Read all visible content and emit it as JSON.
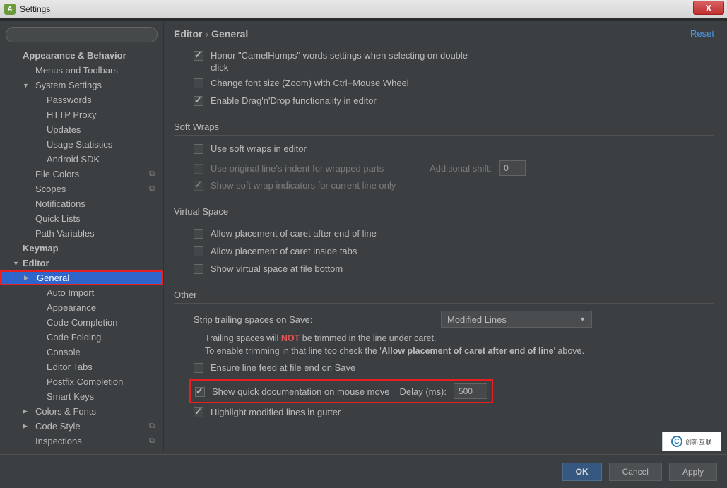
{
  "window": {
    "title": "Settings"
  },
  "search": {
    "placeholder": ""
  },
  "breadcrumb": {
    "root": "Editor",
    "leaf": "General"
  },
  "reset": "Reset",
  "tree": {
    "appearance": "Appearance & Behavior",
    "menus": "Menus and Toolbars",
    "system": "System Settings",
    "passwords": "Passwords",
    "http": "HTTP Proxy",
    "updates": "Updates",
    "usage": "Usage Statistics",
    "sdk": "Android SDK",
    "filecolors": "File Colors",
    "scopes": "Scopes",
    "notifications": "Notifications",
    "quicklists": "Quick Lists",
    "pathvars": "Path Variables",
    "keymap": "Keymap",
    "editor": "Editor",
    "general": "General",
    "autoimport": "Auto Import",
    "appearance2": "Appearance",
    "codecompletion": "Code Completion",
    "codefolding": "Code Folding",
    "console": "Console",
    "editortabs": "Editor Tabs",
    "postfix": "Postfix Completion",
    "smartkeys": "Smart Keys",
    "colorsfonts": "Colors & Fonts",
    "codestyle": "Code Style",
    "inspections": "Inspections"
  },
  "opts": {
    "camelhumps": "Honor \"CamelHumps\" words settings when selecting on double click",
    "zoom": "Change font size (Zoom) with Ctrl+Mouse Wheel",
    "dnd": "Enable Drag'n'Drop functionality in editor",
    "softwraps_title": "Soft Wraps",
    "softwraps": "Use soft wraps in editor",
    "origindent": "Use original line's indent for wrapped parts",
    "addshift": "Additional shift:",
    "addshift_val": "0",
    "indicators": "Show soft wrap indicators for current line only",
    "vspace_title": "Virtual Space",
    "caret_eol": "Allow placement of caret after end of line",
    "caret_tabs": "Allow placement of caret inside tabs",
    "vspace_bottom": "Show virtual space at file bottom",
    "other_title": "Other",
    "strip": "Strip trailing spaces on Save:",
    "strip_select": "Modified Lines",
    "note1a": "Trailing spaces will ",
    "note1b": "NOT",
    "note1c": " be trimmed in the line under caret.",
    "note2a": "To enable trimming in that line too check the '",
    "note2b": "Allow placement of caret after end of line",
    "note2c": "' above.",
    "linefeed": "Ensure line feed at file end on Save",
    "quickdoc": "Show quick documentation on mouse move",
    "delay": "Delay (ms):",
    "delay_val": "500",
    "highlight": "Highlight modified lines in gutter"
  },
  "buttons": {
    "ok": "OK",
    "cancel": "Cancel",
    "apply": "Apply"
  },
  "watermark": "创新互联"
}
